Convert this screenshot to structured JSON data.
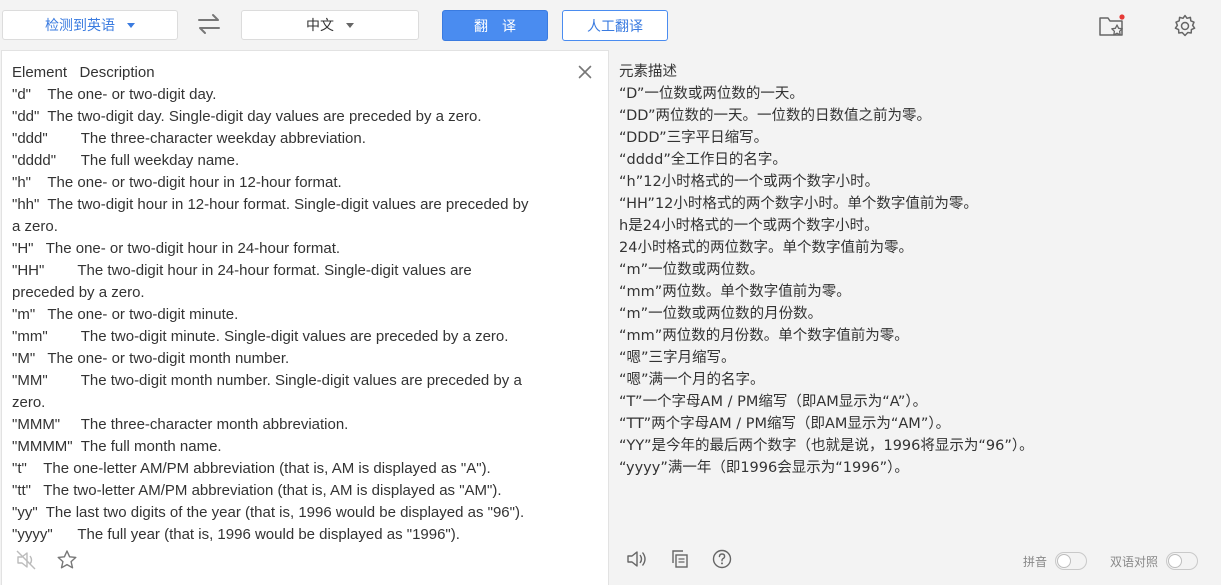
{
  "toolbar": {
    "source_lang": "检测到英语",
    "target_lang": "中文",
    "translate_label": "翻译",
    "human_translate_label": "人工翻译",
    "icons": {
      "swap": "swap-arrows-icon",
      "favorites": "favorites-folder-icon",
      "settings": "gear-icon"
    },
    "accent_color": "#4a8cf0",
    "notification_dot_color": "#e53935"
  },
  "source": {
    "lines": [
      "Element   Description",
      "\"d\"    The one- or two-digit day.",
      "\"dd\"  The two-digit day. Single-digit day values are preceded by a zero.",
      "\"ddd\"        The three-character weekday abbreviation.",
      "\"dddd\"      The full weekday name.",
      "\"h\"    The one- or two-digit hour in 12-hour format.",
      "\"hh\"  The two-digit hour in 12-hour format. Single-digit values are preceded by",
      "a zero.",
      "\"H\"   The one- or two-digit hour in 24-hour format.",
      "\"HH\"        The two-digit hour in 24-hour format. Single-digit values are",
      "preceded by a zero.",
      "\"m\"   The one- or two-digit minute.",
      "\"mm\"        The two-digit minute. Single-digit values are preceded by a zero.",
      "\"M\"   The one- or two-digit month number.",
      "\"MM\"        The two-digit month number. Single-digit values are preceded by a",
      "zero.",
      "\"MMM\"     The three-character month abbreviation.",
      "\"MMMM\"  The full month name.",
      "\"t\"    The one-letter AM/PM abbreviation (that is, AM is displayed as \"A\").",
      "\"tt\"   The two-letter AM/PM abbreviation (that is, AM is displayed as \"AM\").",
      "\"yy\"  The last two digits of the year (that is, 1996 would be displayed as \"96\").",
      "\"yyyy\"      The full year (that is, 1996 would be displayed as \"1996\")."
    ],
    "icons": {
      "close": "close-icon",
      "speaker": "speaker-muted-icon",
      "star": "star-icon"
    }
  },
  "target": {
    "lines": [
      "元素描述",
      "“D”一位数或两位数的一天。",
      "“DD”两位数的一天。一位数的日数值之前为零。",
      "“DDD”三字平日缩写。",
      "“dddd”全工作日的名字。",
      "“h”12小时格式的一个或两个数字小时。",
      "“HH”12小时格式的两个数字小时。单个数字值前为零。",
      "h是24小时格式的一个或两个数字小时。",
      "24小时格式的两位数字。单个数字值前为零。",
      "“m”一位数或两位数。",
      "“mm”两位数。单个数字值前为零。",
      "“m”一位数或两位数的月份数。",
      "“mm”两位数的月份数。单个数字值前为零。",
      "“嗯”三字月缩写。",
      "“嗯”满一个月的名字。",
      "“T”一个字母AM / PM缩写（即AM显示为“A”）。",
      "“TT”两个字母AM / PM缩写（即AM显示为“AM”）。",
      "“YY”是今年的最后两个数字（也就是说，1996将显示为“96”）。",
      "“yyyy”满一年（即1996会显示为“1996”）。"
    ],
    "pinyin_label": "拼音",
    "bilingual_label": "双语对照",
    "icons": {
      "speaker": "speaker-icon",
      "copy": "copy-icon",
      "help": "help-icon"
    }
  }
}
